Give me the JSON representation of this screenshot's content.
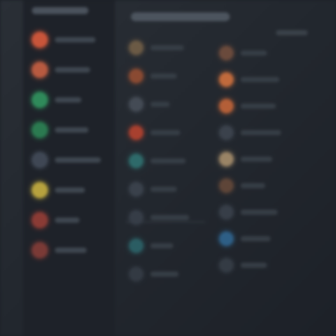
{
  "sidebar": {
    "items": [
      {
        "icon": "orange-circle-icon",
        "color": "#c8553a"
      },
      {
        "icon": "orange-circle-icon",
        "color": "#b85a40"
      },
      {
        "icon": "green-circle-icon",
        "color": "#2f8a5a"
      },
      {
        "icon": "green-circle-icon",
        "color": "#2b7a50"
      },
      {
        "icon": "gray-circle-icon",
        "color": "#3f4754"
      },
      {
        "icon": "yellow-circle-icon",
        "color": "#b7a23e"
      },
      {
        "icon": "red-circle-icon",
        "color": "#8a3b35"
      },
      {
        "icon": "red-circle-icon",
        "color": "#7a3a36"
      }
    ]
  },
  "middle_column": {
    "items": [
      {
        "icon": "tan-circle-icon",
        "color": "#6b5a45"
      },
      {
        "icon": "orange-circle-icon",
        "color": "#8a4a32"
      },
      {
        "icon": "gray-circle-icon",
        "color": "#444b55"
      },
      {
        "icon": "red-circle-icon",
        "color": "#a8402f"
      },
      {
        "icon": "teal-circle-icon",
        "color": "#2e6a6a"
      },
      {
        "icon": "gray-circle-icon",
        "color": "#3a414b"
      },
      {
        "icon": "gray-circle-icon",
        "color": "#363d47"
      },
      {
        "icon": "teal-circle-icon",
        "color": "#2b5d63"
      },
      {
        "icon": "gray-circle-icon",
        "color": "#333a43"
      }
    ]
  },
  "right_column": {
    "items": [
      {
        "icon": "brown-circle-icon",
        "color": "#6a4a3c"
      },
      {
        "icon": "orange-circle-icon",
        "color": "#c06a3c"
      },
      {
        "icon": "orange-circle-icon",
        "color": "#b45f38"
      },
      {
        "icon": "gray-circle-icon",
        "color": "#3b424c"
      },
      {
        "icon": "tan-circle-icon",
        "color": "#9a8466"
      },
      {
        "icon": "brown-circle-icon",
        "color": "#5e4538"
      },
      {
        "icon": "gray-circle-icon",
        "color": "#373e48"
      },
      {
        "icon": "blue-circle-icon",
        "color": "#2e5f86"
      },
      {
        "icon": "gray-circle-icon",
        "color": "#343b44"
      }
    ]
  }
}
